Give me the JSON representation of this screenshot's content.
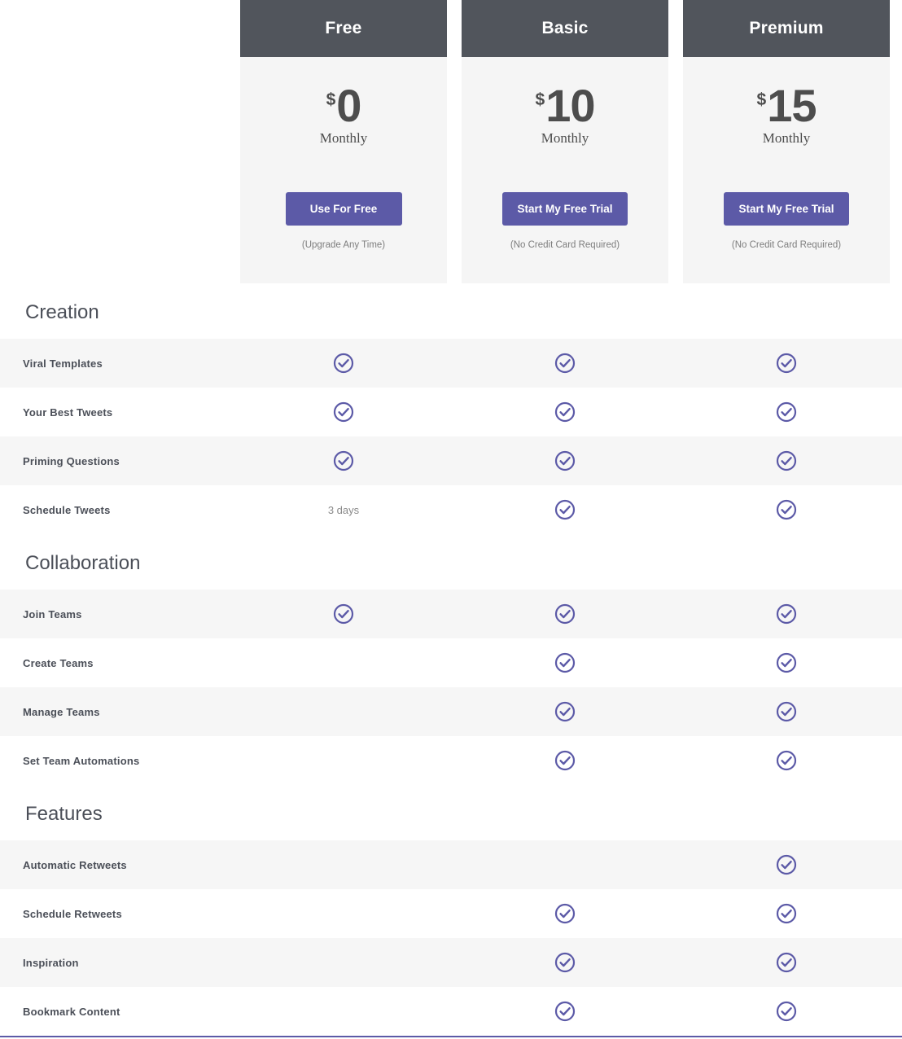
{
  "plans": [
    {
      "name": "Free",
      "currency": "$",
      "amount": "0",
      "period": "Monthly",
      "cta": "Use For Free",
      "note": "(Upgrade Any Time)"
    },
    {
      "name": "Basic",
      "currency": "$",
      "amount": "10",
      "period": "Monthly",
      "cta": "Start My Free Trial",
      "note": "(No Credit Card Required)"
    },
    {
      "name": "Premium",
      "currency": "$",
      "amount": "15",
      "period": "Monthly",
      "cta": "Start My Free Trial",
      "note": "(No Credit Card Required)"
    }
  ],
  "colors": {
    "header_bg": "#51555c",
    "card_bg": "#f5f5f5",
    "accent_purple": "#5c5aa7",
    "row_alt_bg": "#f6f6f6",
    "text_dark": "#4b4f58",
    "text_muted": "#8a8a8a"
  },
  "sections": [
    {
      "title": "Creation",
      "rows": [
        {
          "label": "Viral Templates",
          "cells": [
            "check",
            "check",
            "check"
          ]
        },
        {
          "label": "Your Best Tweets",
          "cells": [
            "check",
            "check",
            "check"
          ]
        },
        {
          "label": "Priming Questions",
          "cells": [
            "check",
            "check",
            "check"
          ]
        },
        {
          "label": "Schedule Tweets",
          "cells": [
            "3 days",
            "check",
            "check"
          ]
        }
      ]
    },
    {
      "title": "Collaboration",
      "rows": [
        {
          "label": "Join Teams",
          "cells": [
            "check",
            "check",
            "check"
          ]
        },
        {
          "label": "Create Teams",
          "cells": [
            "",
            "check",
            "check"
          ]
        },
        {
          "label": "Manage Teams",
          "cells": [
            "",
            "check",
            "check"
          ]
        },
        {
          "label": "Set Team Automations",
          "cells": [
            "",
            "check",
            "check"
          ]
        }
      ]
    },
    {
      "title": "Features",
      "rows": [
        {
          "label": "Automatic Retweets",
          "cells": [
            "",
            "",
            "check"
          ]
        },
        {
          "label": "Schedule Retweets",
          "cells": [
            "",
            "check",
            "check"
          ]
        },
        {
          "label": "Inspiration",
          "cells": [
            "",
            "check",
            "check"
          ]
        },
        {
          "label": "Bookmark Content",
          "cells": [
            "",
            "check",
            "check"
          ]
        }
      ]
    }
  ],
  "icons": {
    "check": "check-circle-icon"
  }
}
